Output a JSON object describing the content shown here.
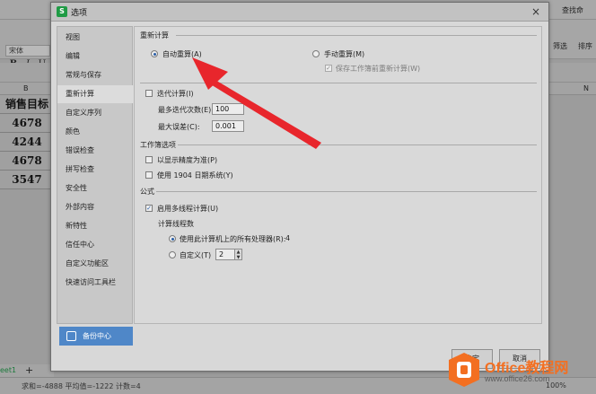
{
  "background": {
    "font_box": "宋体",
    "format_buttons": [
      "B",
      "I",
      "U"
    ],
    "col_b": "B",
    "col_n": "N",
    "header_cell": "销售目标",
    "cells": [
      "4678",
      "4244",
      "4678",
      "3547"
    ],
    "sheet_tab": "eet1",
    "add_sheet": "+",
    "status_text": "求和=-4888  平均值=-1222  计数=4",
    "zoom": "100%",
    "right_labels": {
      "find": "查找命",
      "filter": "筛选",
      "sort": "排序"
    }
  },
  "dialog": {
    "title": "选项",
    "app_icon_letter": "S",
    "close": "×",
    "sidebar": [
      {
        "label": "视图"
      },
      {
        "label": "编辑"
      },
      {
        "label": "常规与保存"
      },
      {
        "label": "重新计算",
        "active": true
      },
      {
        "label": "自定义序列"
      },
      {
        "label": "颜色"
      },
      {
        "label": "错误检查"
      },
      {
        "label": "拼写检查"
      },
      {
        "label": "安全性"
      },
      {
        "label": "外部内容"
      },
      {
        "label": "新特性"
      },
      {
        "label": "信任中心"
      },
      {
        "label": "自定义功能区"
      },
      {
        "label": "快速访问工具栏"
      }
    ],
    "backup_label": "备份中心",
    "recalc": {
      "title": "重新计算",
      "auto": "自动重算(A)",
      "manual": "手动重算(M)",
      "save_before": "保存工作簿前重新计算(W)"
    },
    "iteration": {
      "label": "迭代计算(I)",
      "max_iter_label": "最多迭代次数(E):",
      "max_iter_value": "100",
      "max_change_label": "最大误差(C):",
      "max_change_value": "0.001"
    },
    "workbook": {
      "title": "工作簿选项",
      "precision": "以显示精度为准(P)",
      "date1904": "使用 1904 日期系统(Y)"
    },
    "formula": {
      "title": "公式",
      "multithread": "启用多线程计算(U)",
      "threads_title": "计算线程数",
      "use_all": "使用此计算机上的所有处理器(R):",
      "use_all_count": "4",
      "custom": "自定义(T)",
      "custom_value": "2"
    },
    "buttons": {
      "ok": "确定",
      "cancel": "取消"
    }
  },
  "watermark": {
    "brand": "Office教程网",
    "url": "www.office26.com"
  },
  "colors": {
    "accent": "#2a5fa8",
    "backup_btn": "#4f87c8",
    "arrow": "#e8262c",
    "brand": "#f36f21"
  }
}
